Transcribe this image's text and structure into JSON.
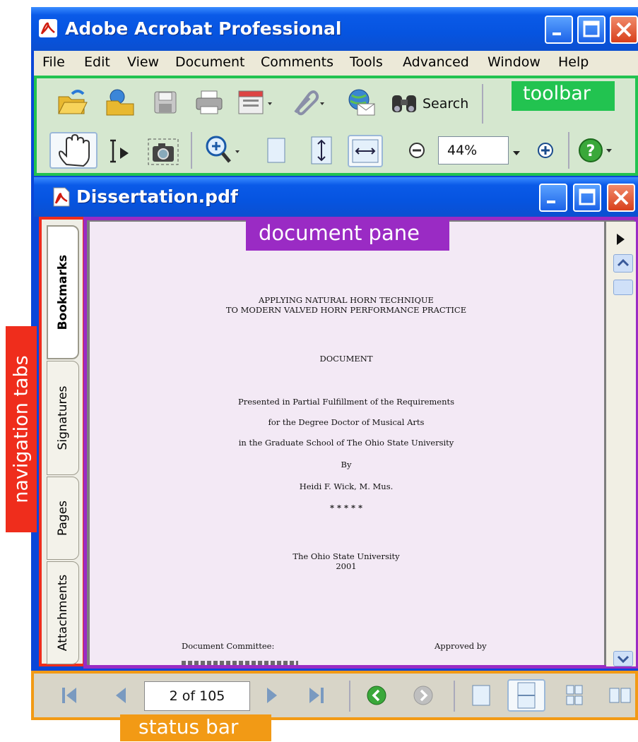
{
  "app": {
    "title": "Adobe Acrobat Professional"
  },
  "menu": [
    "File",
    "Edit",
    "View",
    "Document",
    "Comments",
    "Tools",
    "Advanced",
    "Window",
    "Help"
  ],
  "toolbar": {
    "search_label": "Search",
    "zoom_value": "44%"
  },
  "document": {
    "title": "Dissertation.pdf"
  },
  "nav_tabs": [
    "Bookmarks",
    "Signatures",
    "Pages",
    "Attachments"
  ],
  "pdf_page": {
    "title_line1": "APPLYING NATURAL HORN TECHNIQUE",
    "title_line2": "TO MODERN VALVED HORN PERFORMANCE PRACTICE",
    "doc_type": "DOCUMENT",
    "presented_1": "Presented in Partial Fulfillment of the Requirements",
    "presented_2": "for the Degree Doctor of Musical Arts",
    "presented_3": "in the Graduate School of The Ohio State University",
    "by": "By",
    "author": "Heidi F. Wick, M. Mus.",
    "stars": "* * * * *",
    "university": "The Ohio State University",
    "year": "2001",
    "committee": "Document Committee:",
    "approved": "Approved by"
  },
  "status": {
    "page_indicator": "2 of 105"
  },
  "callouts": {
    "toolbar": "toolbar",
    "document_pane": "document pane",
    "navigation_tabs": "navigation tabs",
    "status_bar": "status bar"
  },
  "colors": {
    "toolbar_callout": "#22c350",
    "document_pane_callout": "#9a2bc4",
    "navigation_callout": "#ef2d1c",
    "status_callout": "#f29a15"
  }
}
